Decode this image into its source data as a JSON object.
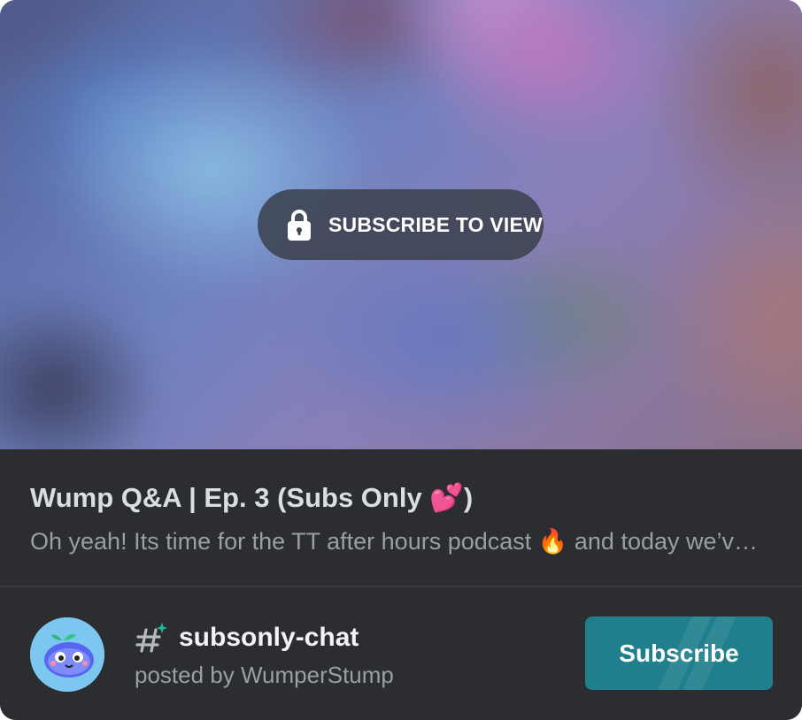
{
  "media": {
    "lock_icon": "lock-icon",
    "overlay_label": "SUBSCRIBE TO VIEW"
  },
  "post": {
    "title": "Wump Q&A | Ep. 3 (Subs Only 💕)",
    "description": "Oh yeah! Its time for the TT after hours podcast 🔥 and today we’v…"
  },
  "footer": {
    "channel_icon": "hashtag-sparkle-icon",
    "channel_name": "subsonly-chat",
    "posted_by": "posted by WumperStump",
    "subscribe_label": "Subscribe"
  },
  "colors": {
    "card_background": "#2b2d31",
    "subscribe_button": "#1f7f8c",
    "accent_sparkle": "#1abc9c"
  }
}
